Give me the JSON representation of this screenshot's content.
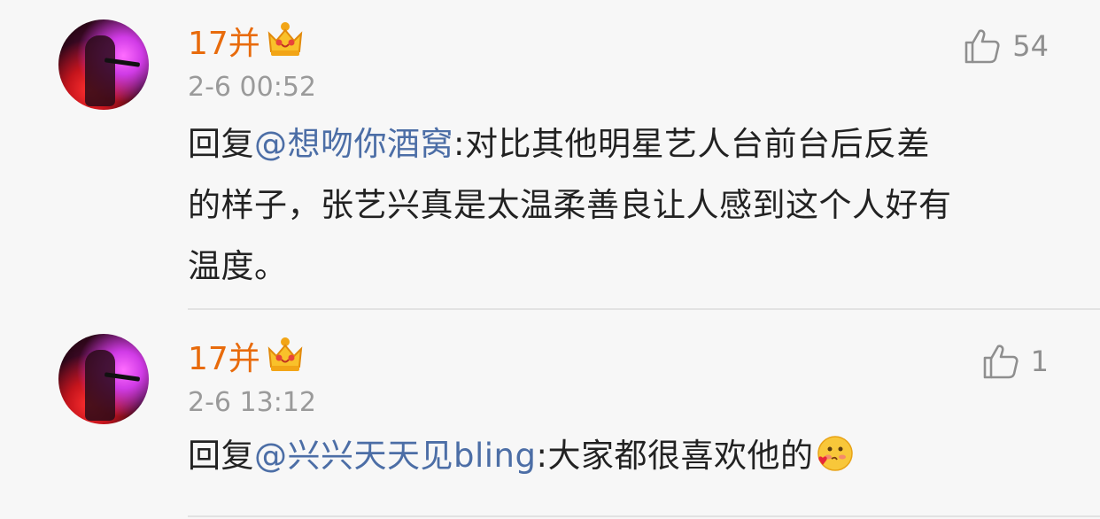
{
  "comments": [
    {
      "username": "17并",
      "timestamp": "2-6 00:52",
      "likes": "54",
      "reply_prefix": "回复",
      "mention": "@想吻你酒窝",
      "separator": ":",
      "line1_rest": "对比其他明星艺人台前台后反差",
      "line2": "的样子，张艺兴真是太温柔善良让人感到这个人好有",
      "line3": "温度。"
    },
    {
      "username": "17并",
      "timestamp": "2-6 13:12",
      "likes": "1",
      "reply_prefix": "回复",
      "mention": "@兴兴天天见bling",
      "separator": ":",
      "body": "大家都很喜欢他的",
      "emoji": "blushing-heart-face"
    }
  ],
  "colors": {
    "username": "#e86b0c",
    "mention": "#4c6ea6",
    "timestamp": "#9a9a9a",
    "background": "#f7f7f7"
  },
  "icons": [
    "crown-badge-icon",
    "thumbs-up-icon",
    "blushing-heart-emoji"
  ]
}
